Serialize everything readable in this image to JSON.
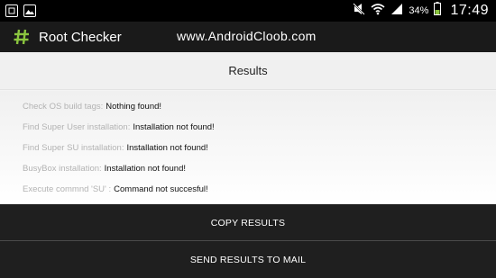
{
  "status_bar": {
    "battery_percent": "34%",
    "time": "17:49",
    "icons": [
      "notification-box-icon",
      "image-icon",
      "mute-icon",
      "wifi-icon",
      "signal-icon",
      "battery-icon"
    ]
  },
  "action_bar": {
    "app_title": "Root Checker",
    "app_icon": "hash-icon",
    "watermark": "www.AndroidCloob.com"
  },
  "results": {
    "header": "Results",
    "items": [
      {
        "label": "Check OS build tags:",
        "value": "Nothing found!"
      },
      {
        "label": "Find Super User installation:",
        "value": "Installation not found!"
      },
      {
        "label": "Find Super SU installation:",
        "value": "Installation not found!"
      },
      {
        "label": "BusyBox installation:",
        "value": "Installation not found!"
      },
      {
        "label": "Execute commnd 'SU' :",
        "value": "Command not succesful!"
      }
    ]
  },
  "buttons": {
    "copy": "COPY RESULTS",
    "send": "SEND RESULTS TO MAIL"
  },
  "colors": {
    "accent_green": "#8bc53f",
    "dark_bar": "#1f1f1f"
  }
}
